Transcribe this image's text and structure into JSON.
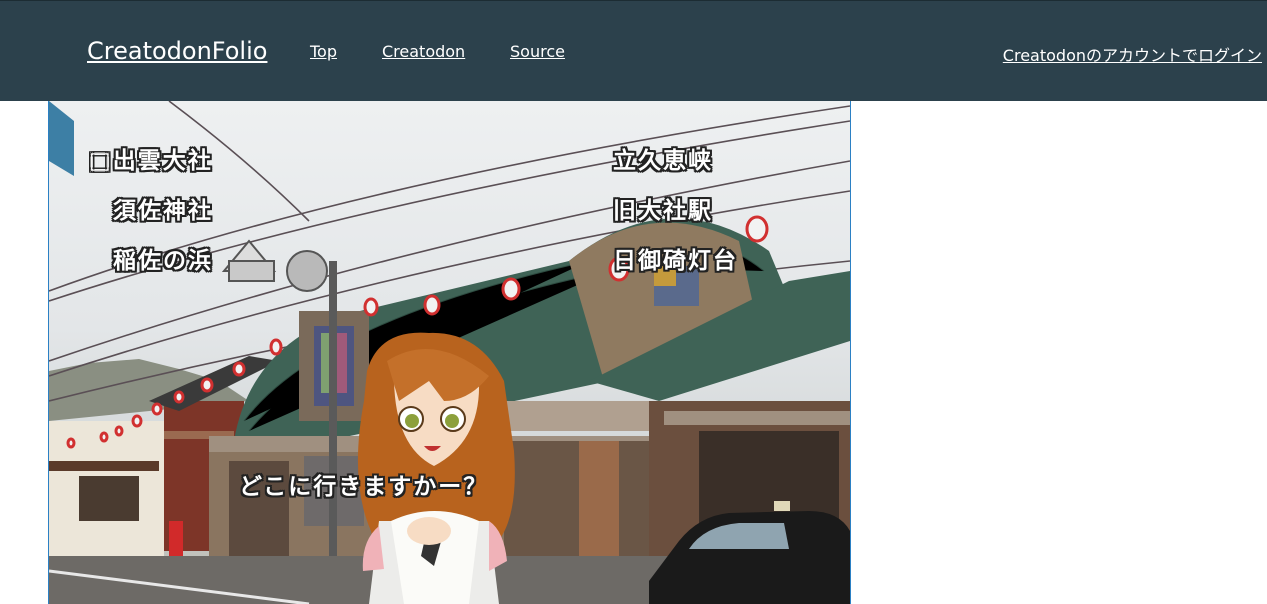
{
  "header": {
    "brand": "CreatodonFolio",
    "nav": [
      {
        "label": "Top"
      },
      {
        "label": "Creatodon"
      },
      {
        "label": "Source"
      }
    ],
    "login": "Creatodonのアカウントでログイン"
  },
  "scene": {
    "choices_left": [
      "□出雲大社",
      "須佐神社",
      "稲佐の浜"
    ],
    "choices_right": [
      "立久恵峡",
      "旧大社駅",
      "日御碕灯台"
    ],
    "dialogue": "どこに行きますかー？"
  },
  "colors": {
    "header_bg": "#2c414c",
    "scene_border": "#2b80c4",
    "roof": "#3f6356"
  }
}
